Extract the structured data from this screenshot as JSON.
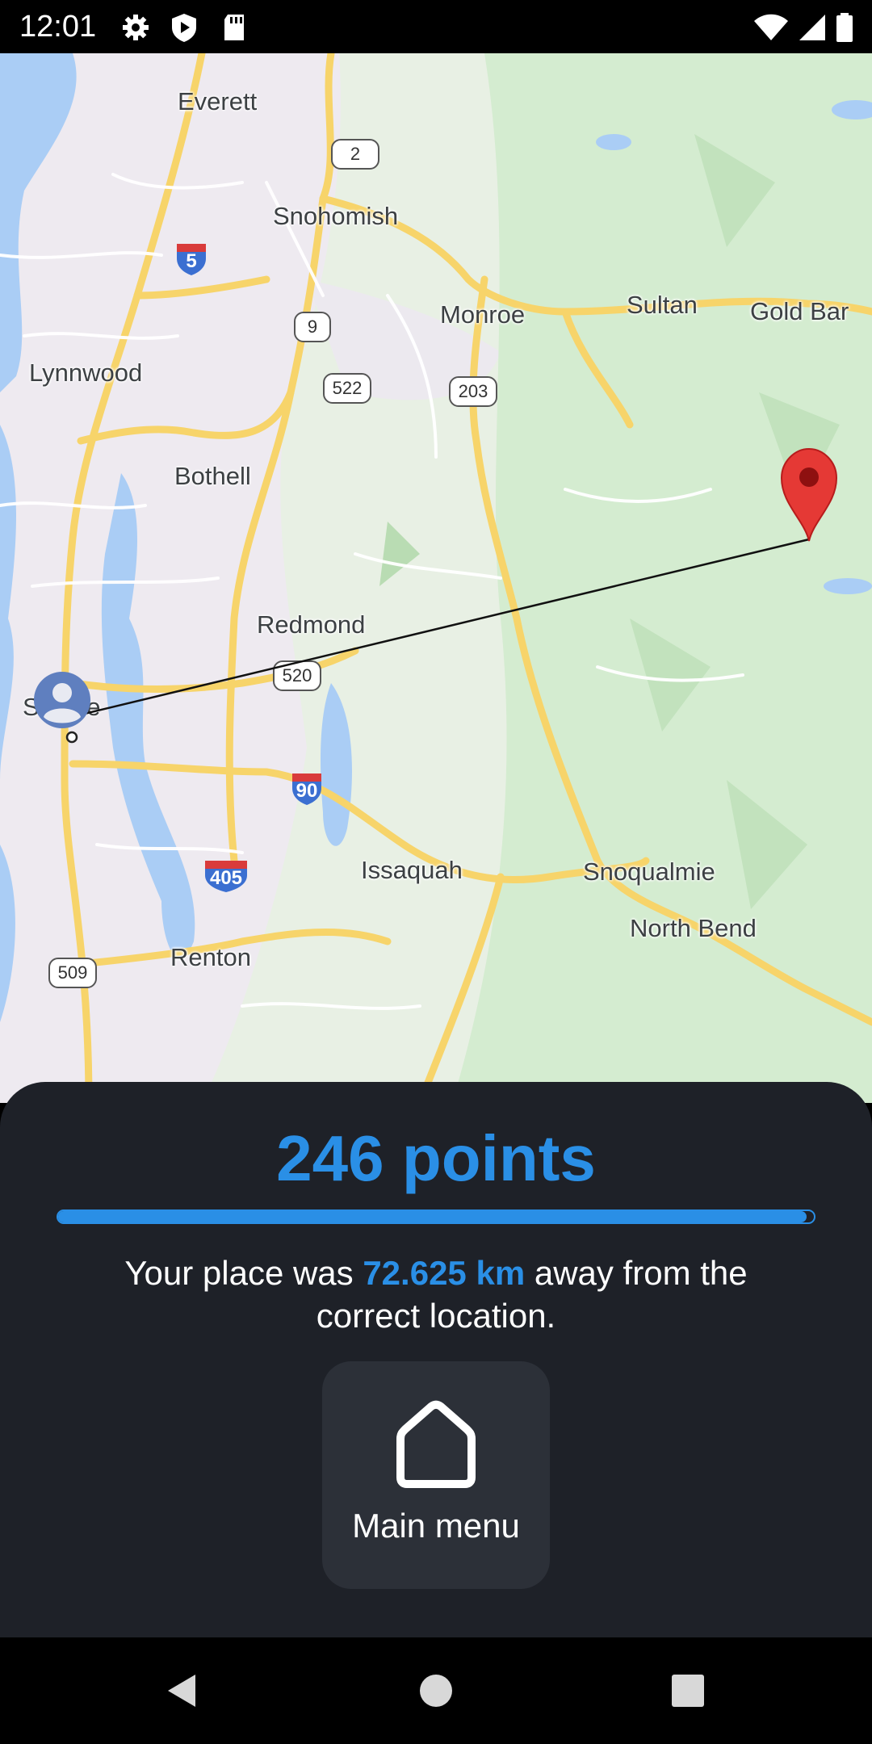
{
  "status_bar": {
    "time": "12:01",
    "left_icons": [
      "settings-icon",
      "shield-icon",
      "sd-card-icon"
    ],
    "right_icons": [
      "wifi-icon",
      "signal-icon",
      "battery-icon"
    ]
  },
  "map": {
    "cities": [
      "Everett",
      "Snohomish",
      "Monroe",
      "Sultan",
      "Gold Bar",
      "Lynnwood",
      "Bothell",
      "Redmond",
      "Seattle",
      "Issaquah",
      "Snoqualmie",
      "North Bend",
      "Renton"
    ],
    "route_shields": [
      "2",
      "9",
      "522",
      "203",
      "520",
      "509"
    ],
    "interstate_shields": [
      "5",
      "90",
      "405"
    ],
    "markers": [
      "guess-avatar-marker",
      "correct-location-pin"
    ]
  },
  "result": {
    "points_text": "246 points",
    "score_fraction": 0.99,
    "message_prefix": "Your place was ",
    "distance_text": "72.625 km",
    "message_suffix": " away from the correct location."
  },
  "actions": {
    "main_menu_label": "Main menu"
  },
  "nav_bar": {
    "buttons": [
      "back-icon",
      "home-icon",
      "recents-icon"
    ]
  },
  "colors": {
    "accent": "#2a8fe6",
    "sheet_background": "#1e2128",
    "button_background": "#2c3038",
    "pin_red": "#e53935"
  }
}
